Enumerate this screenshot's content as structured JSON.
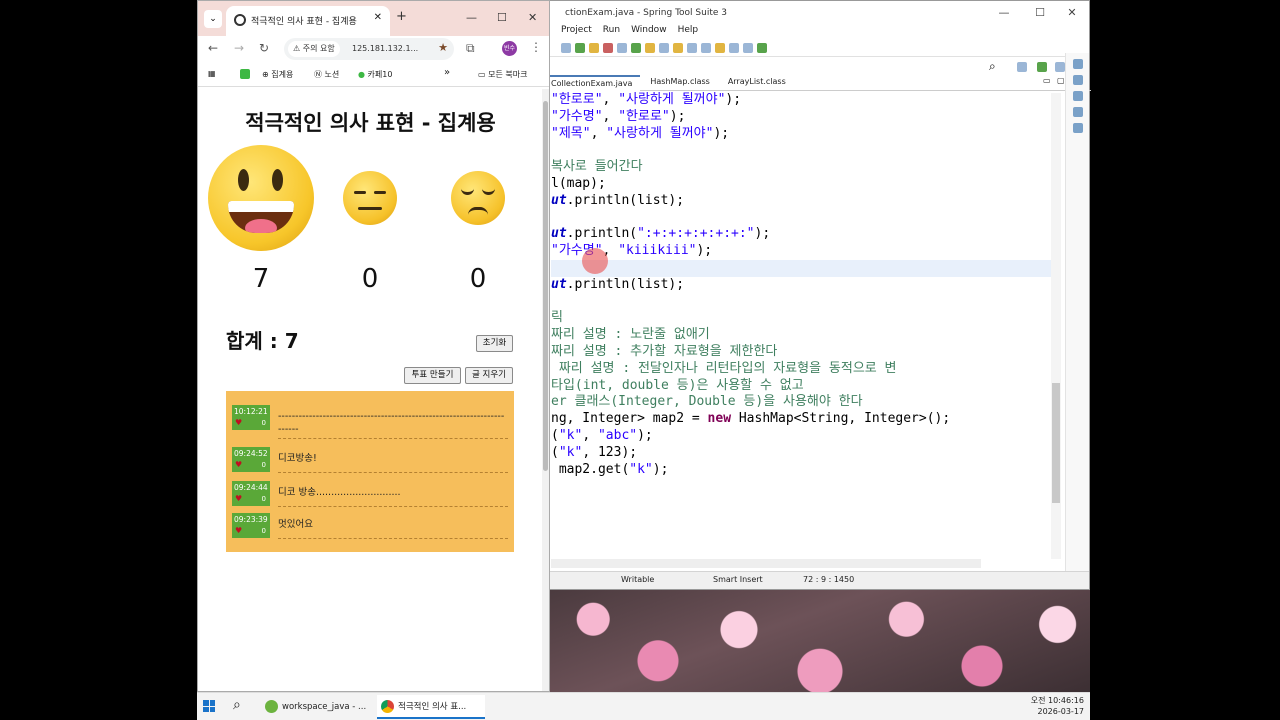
{
  "eclipse": {
    "title": "ctionExam.java - Spring Tool Suite 3",
    "menu": [
      "Project",
      "Run",
      "Window",
      "Help"
    ],
    "tabs": [
      "CollectionExam.java",
      "HashMap.class",
      "ArrayList.class"
    ],
    "code_lines": [
      [
        [
          "str",
          "\"한로로\""
        ],
        [
          "",
          ", "
        ],
        [
          "str",
          "\"사랑하게 될꺼야\""
        ],
        [
          "",
          ");"
        ]
      ],
      [
        [
          "str",
          "\"가수명\""
        ],
        [
          "",
          ", "
        ],
        [
          "str",
          "\"한로로\""
        ],
        [
          "",
          ");"
        ]
      ],
      [
        [
          "str",
          "\"제목\""
        ],
        [
          "",
          ", "
        ],
        [
          "str",
          "\"사랑하게 될꺼야\""
        ],
        [
          "",
          ");"
        ]
      ],
      [],
      [
        [
          "cmt",
          "복사로 들어간다"
        ]
      ],
      [
        [
          "",
          "l(map);"
        ]
      ],
      [
        [
          "fld",
          "ut"
        ],
        [
          "",
          ".println(list);"
        ]
      ],
      [],
      [
        [
          "fld",
          "ut"
        ],
        [
          "",
          ".println("
        ],
        [
          "str",
          "\":+:+:+:+:+:+:\""
        ],
        [
          "",
          ");"
        ]
      ],
      [
        [
          "str",
          "\"가수명\""
        ],
        [
          "",
          ", "
        ],
        [
          "str",
          "\"kiiikiii\""
        ],
        [
          "",
          ");"
        ]
      ],
      [
        [
          "",
          ""
        ]
      ],
      [
        [
          "fld",
          "ut"
        ],
        [
          "",
          ".println(list);"
        ]
      ],
      [],
      [
        [
          "cmt",
          "릭"
        ]
      ],
      [
        [
          "cmt",
          "짜리 설명 : 노란줄 없애기"
        ]
      ],
      [
        [
          "cmt",
          "짜리 설명 : 추가할 자료형을 제한한다"
        ]
      ],
      [
        [
          "cmt",
          " 짜리 설명 : 전달인자나 리턴타입의 자료형을 동적으로 변"
        ]
      ],
      [
        [
          "cmt",
          "타입(int, double 등)은 사용할 수 없고"
        ]
      ],
      [
        [
          "cmt",
          "er 클래스(Integer, Double 등)을 사용해야 한다"
        ]
      ],
      [
        [
          "",
          "ng, Integer> map2 = "
        ],
        [
          "kw",
          "new"
        ],
        [
          "",
          " HashMap<String, Integer>();"
        ]
      ],
      [
        [
          "",
          "("
        ],
        [
          "str",
          "\"k\""
        ],
        [
          "",
          ", "
        ],
        [
          "str",
          "\"abc\""
        ],
        [
          "",
          ");"
        ]
      ],
      [
        [
          "",
          "("
        ],
        [
          "str",
          "\"k\""
        ],
        [
          "",
          ", 123);"
        ]
      ],
      [
        [
          "",
          ""
        ],
        [
          "",
          " map2.get("
        ],
        [
          "str",
          "\"k\""
        ],
        [
          "",
          ");"
        ]
      ]
    ],
    "highlight_line": 10,
    "status": {
      "mode": "Writable",
      "insert": "Smart Insert",
      "position": "72 : 9 : 1450"
    },
    "window_controls": [
      "—",
      "☐",
      "✕"
    ]
  },
  "chrome": {
    "tab_title": "적극적인 의사 표현 - 집계용",
    "tab_close": "✕",
    "new_tab": "+",
    "window_controls": [
      "—",
      "☐",
      "✕"
    ],
    "security_label": "주의 요함",
    "url": "125.181.132.1...",
    "profile_initial": "빈수",
    "bookmarks": [
      "집계용",
      "노션",
      "카페10",
      "모든 북마크"
    ],
    "bookmarks_more": "»"
  },
  "page": {
    "title": "적극적인 의사 표현 - 집계용",
    "counts": [
      "7",
      "0",
      "0"
    ],
    "total_label": "합계 : 7",
    "reset_button": "초기화",
    "make_vote_button": "투표 만들기",
    "big_text_button": "글 지우기",
    "entries": [
      {
        "time": "10:12:21",
        "count": "0",
        "text": "------------------------------------------------------------------------"
      },
      {
        "time": "09:24:52",
        "count": "0",
        "text": "디코방송!"
      },
      {
        "time": "09:24:44",
        "count": "0",
        "text": "디코 방송............................"
      },
      {
        "time": "09:23:39",
        "count": "0",
        "text": "멋있어요"
      }
    ]
  },
  "taskbar": {
    "items": [
      "workspace_java - ...",
      "적극적인 의사 표..."
    ],
    "clock_time": "오전 10:46:16",
    "clock_date": "2026-03-17"
  }
}
